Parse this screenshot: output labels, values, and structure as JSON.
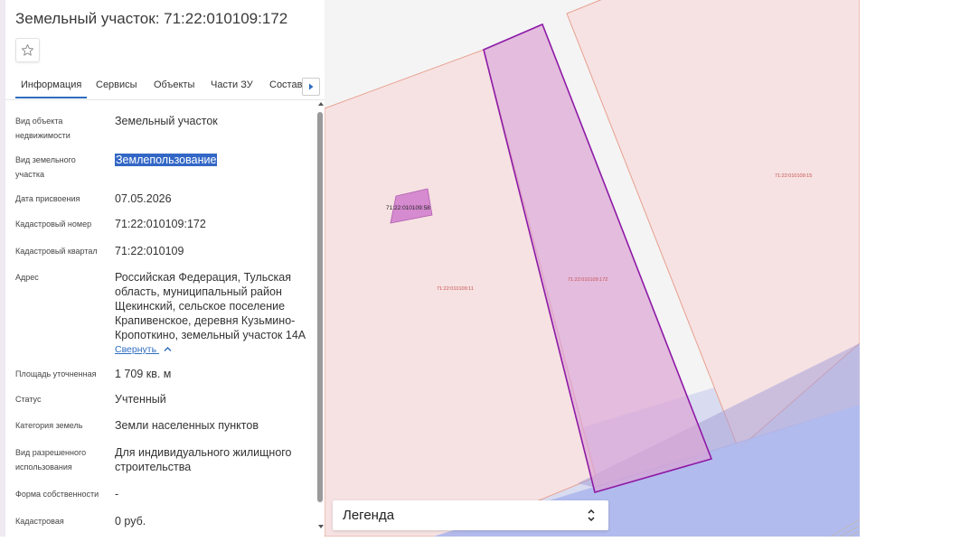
{
  "header": {
    "title": "Земельный участок: 71:22:010109:172"
  },
  "tabs": [
    {
      "label": "Информация",
      "active": true
    },
    {
      "label": "Сервисы"
    },
    {
      "label": "Объекты"
    },
    {
      "label": "Части ЗУ"
    },
    {
      "label": "Состав"
    }
  ],
  "info": {
    "object_type_label": "Вид объекта недвижимости",
    "object_type_value": "Земельный участок",
    "parcel_type_label": "Вид земельного участка",
    "parcel_type_value": "Землепользование",
    "date_label": "Дата присвоения",
    "date_value": "07.05.2026",
    "cad_number_label": "Кадастровый номер",
    "cad_number_value": "71:22:010109:172",
    "cad_quarter_label": "Кадастровый квартал",
    "cad_quarter_value": "71:22:010109",
    "address_label": "Адрес",
    "address_value": "Российская Федерация, Тульская область, муниципальный район Щекинский, сельское поселение Крапивенское, деревня Кузьмино-Кропоткино, земельный участок 14А",
    "collapse_label": "Свернуть",
    "area_label": "Площадь уточненная",
    "area_value": "1 709 кв. м",
    "status_label": "Статус",
    "status_value": "Учтенный",
    "category_label": "Категория земель",
    "category_value": "Земли населенных пунктов",
    "permitted_use_label": "Вид разрешенного использования",
    "permitted_use_value": "Для индивидуального жилищного строительства",
    "ownership_label": "Форма собственности",
    "ownership_value": "-",
    "cad_value_label": "Кадастровая",
    "cad_value_value": "0 руб."
  },
  "map": {
    "labels": {
      "parcel_58": "71:22:010109:58",
      "parcel_11": "71:22:010109:11",
      "parcel_172": "71:22:010109:172",
      "parcel_15": "71:22:010109:15"
    },
    "colors": {
      "parcel_fill": "#f6e2e2",
      "parcel_border": "#e8a090",
      "selected_fill": "#dba4d4",
      "selected_border": "#8e1aa6",
      "road_fill": "#b0b8ec"
    }
  },
  "legend": {
    "label": "Легенда"
  },
  "icons": {
    "favorite": "star-icon",
    "tab_scroll": "triangle-right-icon",
    "collapse": "chevron-up-icon",
    "legend_toggle": "up-down-arrows-icon"
  }
}
